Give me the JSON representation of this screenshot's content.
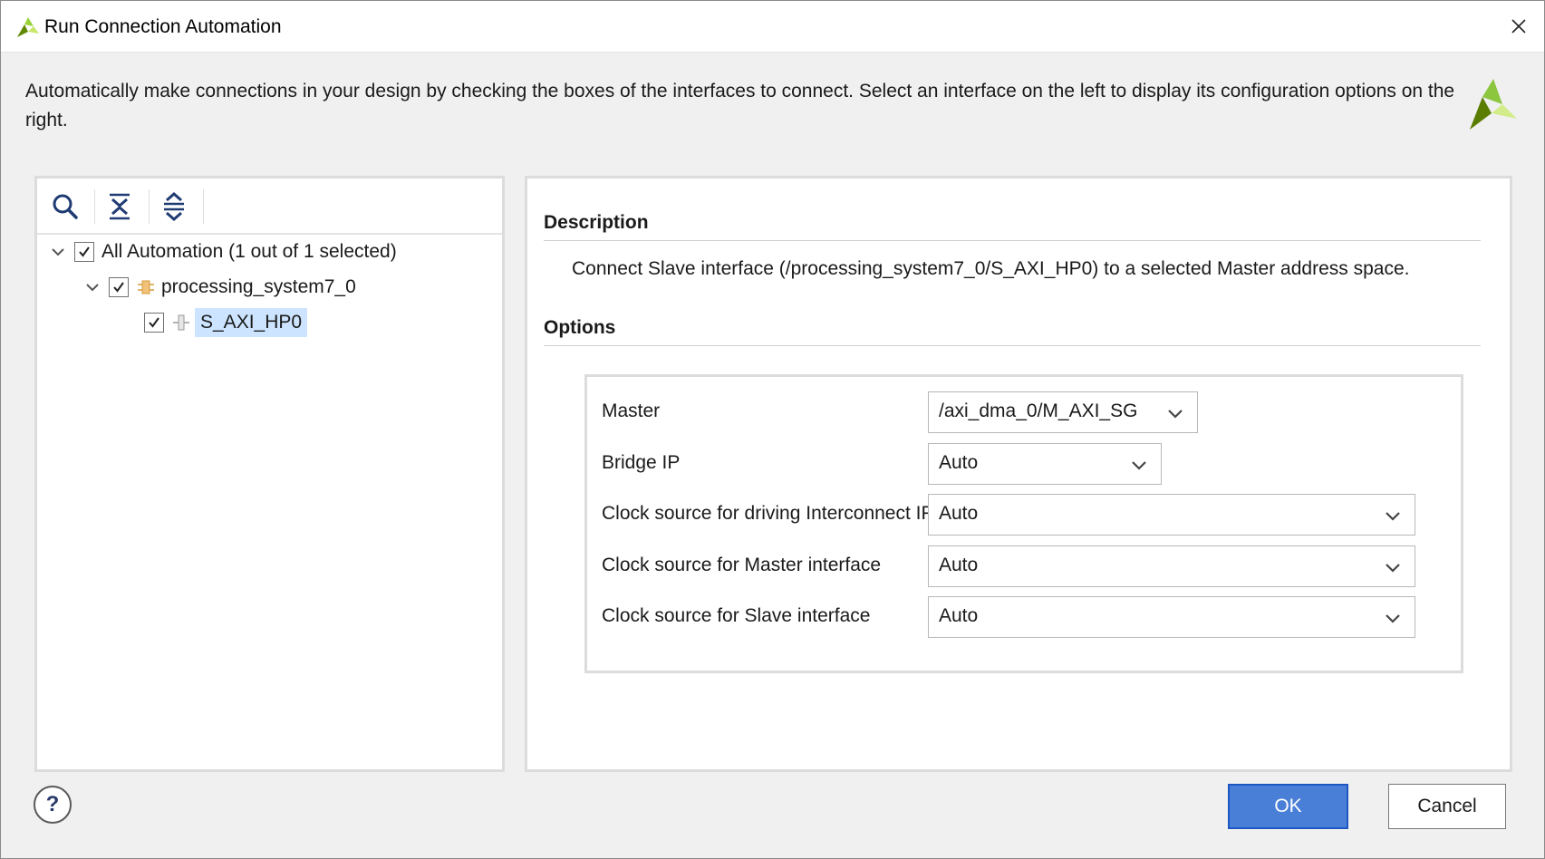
{
  "window": {
    "title": "Run Connection Automation"
  },
  "description": "Automatically make connections in your design by checking the boxes of the interfaces to connect. Select an interface on the left to display its configuration options on the right.",
  "toolbar": {
    "icons": [
      "search-icon",
      "collapse-all-icon",
      "expand-all-icon"
    ]
  },
  "tree": {
    "root_label": "All Automation (1 out of 1 selected)",
    "child_label": "processing_system7_0",
    "leaf_label": "S_AXI_HP0"
  },
  "detail": {
    "description_heading": "Description",
    "description_text": "Connect Slave interface (/processing_system7_0/S_AXI_HP0) to a selected Master address space.",
    "options_heading": "Options",
    "options": [
      {
        "label": "Master",
        "value": "/axi_dma_0/M_AXI_SG"
      },
      {
        "label": "Bridge IP",
        "value": "Auto"
      },
      {
        "label": "Clock source for driving Interconnect IP",
        "value": "Auto"
      },
      {
        "label": "Clock source for Master interface",
        "value": "Auto"
      },
      {
        "label": "Clock source for Slave interface",
        "value": "Auto"
      }
    ]
  },
  "footer": {
    "help_label": "?",
    "ok_label": "OK",
    "cancel_label": "Cancel"
  },
  "colors": {
    "accent": "#4a7fd8",
    "selection": "#cce4ff",
    "logo_green": "#7ab800"
  }
}
